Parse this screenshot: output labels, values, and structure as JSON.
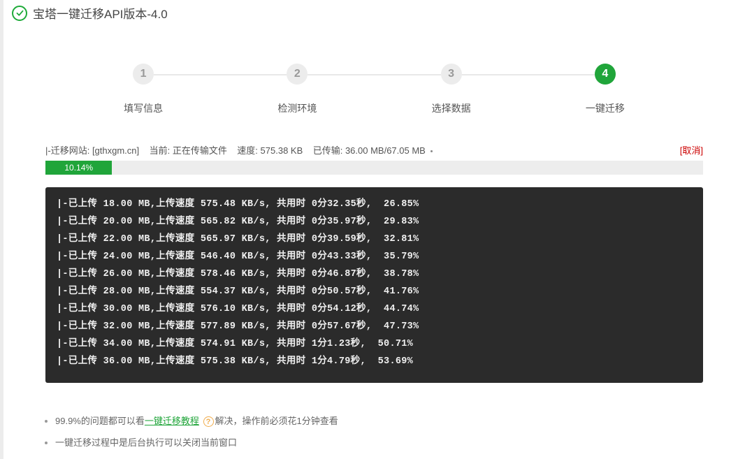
{
  "title": "宝塔一键迁移API版本-4.0",
  "steps": [
    {
      "num": "1",
      "label": "填写信息",
      "active": false
    },
    {
      "num": "2",
      "label": "检测环境",
      "active": false
    },
    {
      "num": "3",
      "label": "选择数据",
      "active": false
    },
    {
      "num": "4",
      "label": "一键迁移",
      "active": true
    }
  ],
  "status": {
    "site_label": "|-迁移网站: ",
    "site_value": "[gthxgm.cn]",
    "current_label": "当前: ",
    "current_value": "正在传输文件",
    "speed_label": "速度: ",
    "speed_value": "575.38 KB",
    "transferred_label": "已传输: ",
    "transferred_value": "36.00 MB/67.05 MB",
    "cancel": "[取消]"
  },
  "progress": {
    "percent_text": "10.14%",
    "percent_value": 10.14
  },
  "log_lines": [
    "|-已上传 18.00 MB,上传速度 575.48 KB/s, 共用时 0分32.35秒,  26.85%",
    "|-已上传 20.00 MB,上传速度 565.82 KB/s, 共用时 0分35.97秒,  29.83%",
    "|-已上传 22.00 MB,上传速度 565.97 KB/s, 共用时 0分39.59秒,  32.81%",
    "|-已上传 24.00 MB,上传速度 546.40 KB/s, 共用时 0分43.33秒,  35.79%",
    "|-已上传 26.00 MB,上传速度 578.46 KB/s, 共用时 0分46.87秒,  38.78%",
    "|-已上传 28.00 MB,上传速度 554.37 KB/s, 共用时 0分50.57秒,  41.76%",
    "|-已上传 30.00 MB,上传速度 576.10 KB/s, 共用时 0分54.12秒,  44.74%",
    "|-已上传 32.00 MB,上传速度 577.89 KB/s, 共用时 0分57.67秒,  47.73%",
    "|-已上传 34.00 MB,上传速度 574.91 KB/s, 共用时 1分1.23秒,  50.71%",
    "|-已上传 36.00 MB,上传速度 575.38 KB/s, 共用时 1分4.79秒,  53.69%"
  ],
  "tips": {
    "line1_prefix": "99.9%的问题都可以看",
    "line1_link": "一键迁移教程",
    "line1_suffix": "解决，操作前必须花1分钟查看",
    "line2": "一键迁移过程中是后台执行可以关闭当前窗口"
  }
}
